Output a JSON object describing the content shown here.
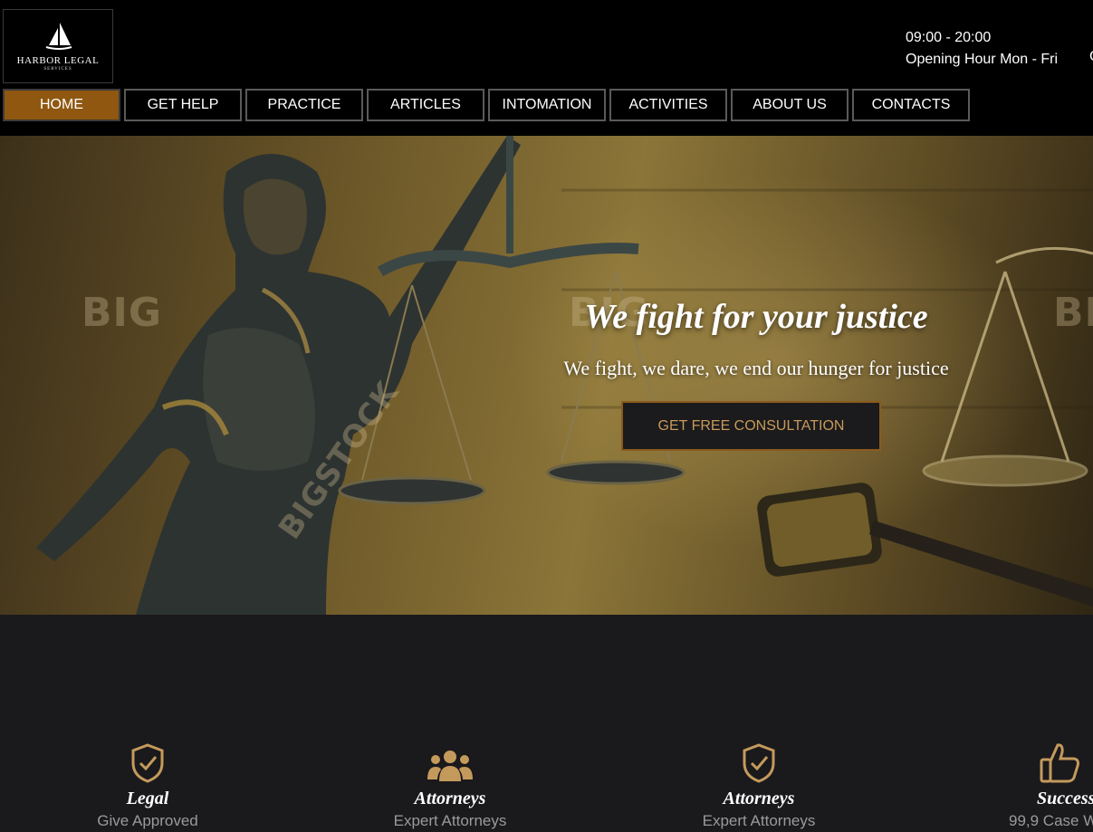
{
  "brand": {
    "name": "HARBOR LEGAL",
    "tagline": "SERVICES"
  },
  "header": {
    "hours_time": "09:00 - 20:00",
    "hours_label": "Opening Hour Mon - Fri",
    "edge_glyph": "C"
  },
  "nav": {
    "items": [
      {
        "label": "HOME",
        "active": true
      },
      {
        "label": "GET HELP"
      },
      {
        "label": "PRACTICE"
      },
      {
        "label": "ARTICLES"
      },
      {
        "label": "INTOMATION"
      },
      {
        "label": "ACTIVITIES"
      },
      {
        "label": "ABOUT US"
      },
      {
        "label": "CONTACTS"
      }
    ]
  },
  "hero": {
    "title": "We fight for your justice",
    "subtitle": "We fight, we dare, we end our hunger for justice",
    "cta_label": "GET FREE CONSULTATION",
    "watermarks": [
      "BIG",
      "BIG",
      "BIG",
      "BIGSTOCK"
    ]
  },
  "features": [
    {
      "icon": "shield-check-icon",
      "title": "Legal",
      "subtitle": "Give Approved"
    },
    {
      "icon": "users-icon",
      "title": "Attorneys",
      "subtitle": "Expert Attorneys"
    },
    {
      "icon": "shield-check-icon",
      "title": "Attorneys",
      "subtitle": "Expert Attorneys"
    },
    {
      "icon": "thumbs-up-icon",
      "title": "Success",
      "subtitle": "99,9 Case W"
    }
  ],
  "colors": {
    "accent": "#8f5710",
    "gold": "#c49a5c",
    "features_bg": "#1a191c",
    "subtext": "#9a9a9a"
  }
}
